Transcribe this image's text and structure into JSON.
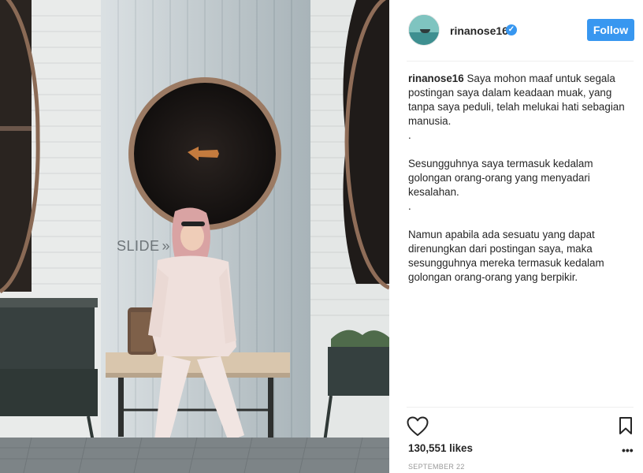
{
  "photo": {
    "overlay_text": "SLIDE",
    "overlay_arrow": "»"
  },
  "post": {
    "username": "rinanose16",
    "verified_icon": "verified-badge-icon",
    "follow_label": "Follow",
    "caption": {
      "username": "rinanose16",
      "paragraphs": [
        "Saya mohon maaf untuk segala postingan saya dalam keadaan muak, yang tanpa saya peduli, telah melukai hati sebagian manusia.",
        ".",
        "Sesungguhnya saya termasuk kedalam golongan orang-orang yang menyadari kesalahan.",
        ".",
        "Namun apabila ada sesuatu yang dapat direnungkan dari postingan saya, maka sesungguhnya mereka termasuk kedalam golongan orang-orang yang berpikir."
      ]
    },
    "likes": "130,551 likes",
    "date": "SEPTEMBER 22",
    "more_label": "•••"
  },
  "colors": {
    "accent": "#3897f0",
    "text": "#262626",
    "muted": "#999999"
  }
}
